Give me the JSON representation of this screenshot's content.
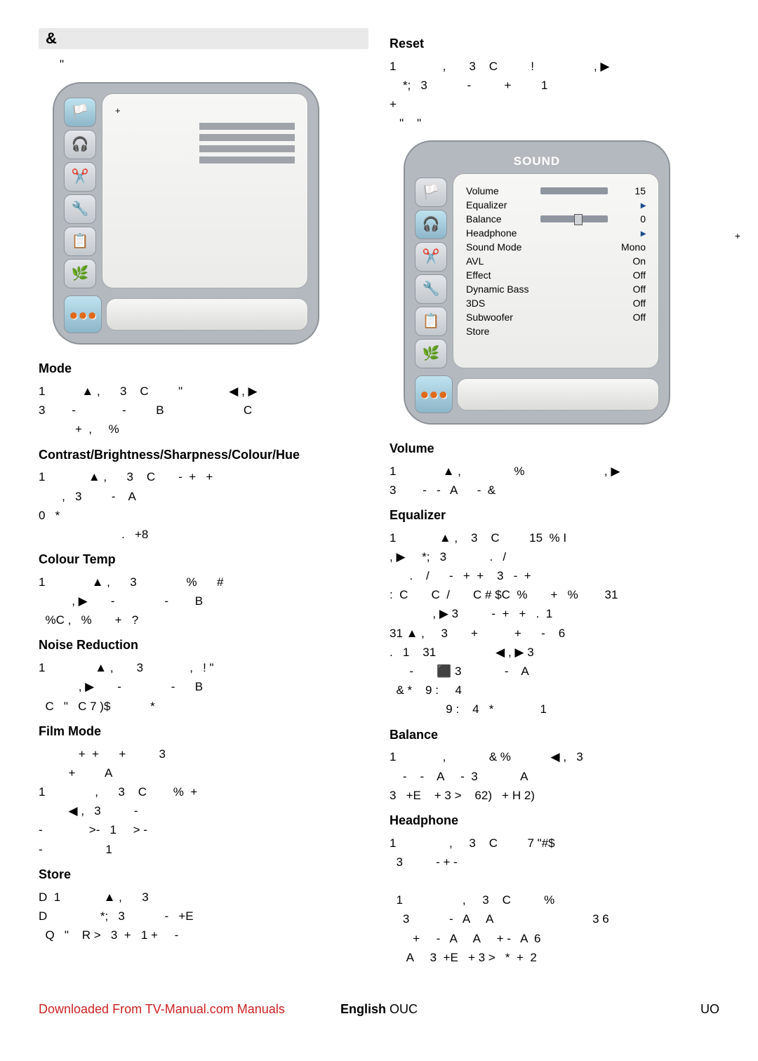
{
  "left": {
    "topbar": "&",
    "indent": "\"",
    "plus": "+",
    "headings": {
      "mode": "Mode",
      "cbsch": "Contrast/Brightness/Sharpness/Colour/Hue",
      "colourtemp": "Colour Temp",
      "nr": "Noise Reduction",
      "filmmode": "Film Mode",
      "store": "Store"
    },
    "mode_text": "1           ▲ ,      3    C         \"              ◀ , ▶\n3        -              -         B                        C\n           +  ,     %",
    "cbsch_text": "1             ▲ ,      3    C       -  +   +\n       ,   3         -    A\n0   *\n                         .   +8",
    "colourtemp_text": "1              ▲ ,      3               %      #\n          , ▶       -               -        B\n  %C ,   %       +   ?",
    "nr_text": "1               ▲ ,       3              ,   ! \"\n            , ▶       -               -      B\n  C   \"   C 7 )$            *",
    "filmmode_text": "            +  +      +          3\n         +         A\n1               ,      3    C        %  +\n         ◀ ,   3          -\n-              >-   1     > -\n-                   1",
    "store_text": "D  1             ▲ ,      3\nD                *;   3            -   +E\n  Q   \"    R >   3  +   1 +     -"
  },
  "right": {
    "reset_head": "Reset",
    "reset_text": "1              ,       3    C          !                  , ▶\n    *;   3            -          +         1\n+\n   \"    \"",
    "osd_title": "SOUND",
    "osd_items": [
      {
        "label": "Volume",
        "val": "15",
        "bar": true
      },
      {
        "label": "Equalizer",
        "val": "▸"
      },
      {
        "label": "Balance",
        "val": "0",
        "bar2": true
      },
      {
        "label": "Headphone",
        "val": "▸"
      },
      {
        "label": "Sound Mode",
        "val": "Mono"
      },
      {
        "label": "AVL",
        "val": "On"
      },
      {
        "label": "Effect",
        "val": "Off"
      },
      {
        "label": "Dynamic Bass",
        "val": "Off"
      },
      {
        "label": "3DS",
        "val": "Off"
      },
      {
        "label": "Subwoofer",
        "val": "Off"
      },
      {
        "label": "Store",
        "val": ""
      }
    ],
    "plus_right": "+",
    "headings": {
      "volume": "Volume",
      "equalizer": "Equalizer",
      "balance": "Balance",
      "headphone": "Headphone"
    },
    "volume_text": "1              ▲ ,                %                        , ▶\n3        -   -   A      -  &",
    "equalizer_text": "1             ▲ ,    3    C         15  % I\n, ▶     *;   3             .   /\n      .    /      -   +  +    3   -  +\n:  C       C  /       C # $C  %       +   %        31\n             , ▶ 3          -  +   +   .  1\n31 ▲ ,     3       +           +      -    6\n.   1    31                  ◀ , ▶ 3\n      -       ⬛ 3             -    A\n  & *    9 :     4\n                 9 :    4   *              1",
    "balance_text": "1              ,             & %            ◀ ,   3\n    -    -    A     -  3             A\n3   +E    + 3 >    62)   + H 2)",
    "headphone_text": "1                ,     3    C         7 \"#$\n  3          - + -\n\n  1                  ,     3    C          %\n    3            -   A     A                              3 6\n       +     -   A     A     + -   A  6\n     A     3  +E   + 3 >   *  +  2"
  },
  "footer": {
    "dl": "Downloaded From TV-Manual.com Manuals",
    "mid": "English",
    "midcode": "OUC",
    "right": "UO"
  }
}
